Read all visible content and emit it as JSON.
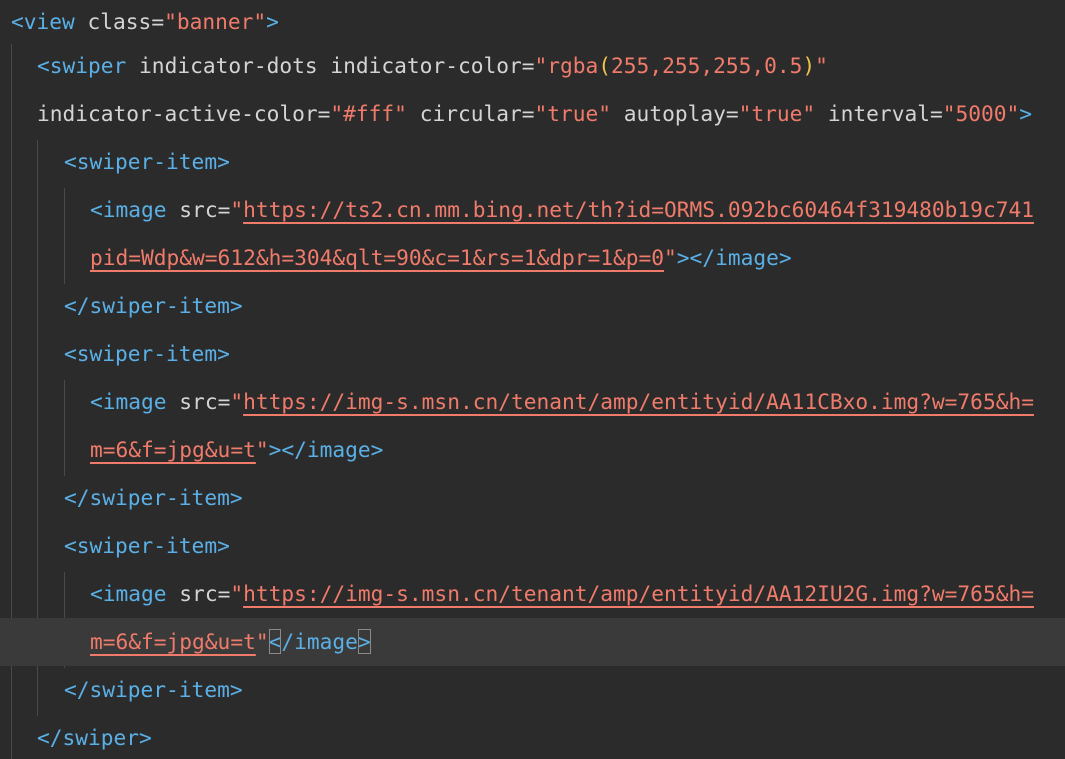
{
  "editor": {
    "lines": [
      {
        "id": 0,
        "tokens": [
          {
            "k": "t",
            "v": "<view"
          },
          {
            "k": "a",
            "v": " class="
          },
          {
            "k": "s",
            "v": "\"banner\""
          },
          {
            "k": "t",
            "v": ">"
          }
        ]
      },
      {
        "id": 1,
        "tokens": [
          {
            "k": "t",
            "v": "<swiper"
          },
          {
            "k": "a",
            "v": " indicator-dots indicator-color="
          },
          {
            "k": "s",
            "v": "\"rgba"
          },
          {
            "k": "y",
            "v": "("
          },
          {
            "k": "s",
            "v": "255,255,255,0.5"
          },
          {
            "k": "y",
            "v": ")"
          },
          {
            "k": "s",
            "v": "\""
          }
        ]
      },
      {
        "id": 2,
        "tokens": [
          {
            "k": "a",
            "v": "indicator-active-color="
          },
          {
            "k": "s",
            "v": "\"#fff\""
          },
          {
            "k": "a",
            "v": " circular="
          },
          {
            "k": "s",
            "v": "\"true\""
          },
          {
            "k": "a",
            "v": " autoplay="
          },
          {
            "k": "s",
            "v": "\"true\""
          },
          {
            "k": "a",
            "v": " interval="
          },
          {
            "k": "s",
            "v": "\"5000\""
          },
          {
            "k": "t",
            "v": ">"
          }
        ]
      },
      {
        "id": 3,
        "tokens": [
          {
            "k": "t",
            "v": "<swiper-item>"
          }
        ]
      },
      {
        "id": 4,
        "tokens": [
          {
            "k": "t",
            "v": "<image"
          },
          {
            "k": "a",
            "v": " src="
          },
          {
            "k": "s",
            "v": "\""
          },
          {
            "k": "u",
            "v": "https://ts2.cn.mm.bing.net/th?id=ORMS.092bc60464f319480b19c741"
          }
        ]
      },
      {
        "id": 5,
        "tokens": [
          {
            "k": "u",
            "v": "pid=Wdp&w=612&h=304&qlt=90&c=1&rs=1&dpr=1&p=0"
          },
          {
            "k": "s",
            "v": "\""
          },
          {
            "k": "t",
            "v": "></image>"
          }
        ]
      },
      {
        "id": 6,
        "tokens": [
          {
            "k": "t",
            "v": "</swiper-item>"
          }
        ]
      },
      {
        "id": 7,
        "tokens": [
          {
            "k": "t",
            "v": "<swiper-item>"
          }
        ]
      },
      {
        "id": 8,
        "tokens": [
          {
            "k": "t",
            "v": "<image"
          },
          {
            "k": "a",
            "v": " src="
          },
          {
            "k": "s",
            "v": "\""
          },
          {
            "k": "u",
            "v": "https://img-s.msn.cn/tenant/amp/entityid/AA11CBxo.img?w=765&h="
          }
        ]
      },
      {
        "id": 9,
        "tokens": [
          {
            "k": "u",
            "v": "m=6&f=jpg&u=t"
          },
          {
            "k": "s",
            "v": "\""
          },
          {
            "k": "t",
            "v": "></image>"
          }
        ]
      },
      {
        "id": 10,
        "tokens": [
          {
            "k": "t",
            "v": "</swiper-item>"
          }
        ]
      },
      {
        "id": 11,
        "tokens": [
          {
            "k": "t",
            "v": "<swiper-item>"
          }
        ]
      },
      {
        "id": 12,
        "tokens": [
          {
            "k": "t",
            "v": "<image"
          },
          {
            "k": "a",
            "v": " src="
          },
          {
            "k": "s",
            "v": "\""
          },
          {
            "k": "u",
            "v": "https://img-s.msn.cn/tenant/amp/entityid/AA12IU2G.img?w=765&h="
          }
        ]
      },
      {
        "id": 13,
        "tokens": [
          {
            "k": "u",
            "v": "m=6&f=jpg&u=t"
          },
          {
            "k": "s",
            "v": "\""
          },
          {
            "k": "t",
            "v": "<",
            "bm": true
          },
          {
            "k": "t",
            "v": "/image"
          },
          {
            "k": "t",
            "v": ">",
            "bm": true
          }
        ]
      },
      {
        "id": 14,
        "tokens": [
          {
            "k": "t",
            "v": "</swiper-item>"
          }
        ]
      },
      {
        "id": 15,
        "tokens": [
          {
            "k": "t",
            "v": "</swiper>"
          }
        ]
      }
    ]
  },
  "theme": {
    "background": "#2b2b2b",
    "current_line": "#3a3a3a",
    "tag": "#5ab0e6",
    "attribute": "#d4d4d4",
    "string": "#f07b6b",
    "bracket": "#f0c54a"
  }
}
